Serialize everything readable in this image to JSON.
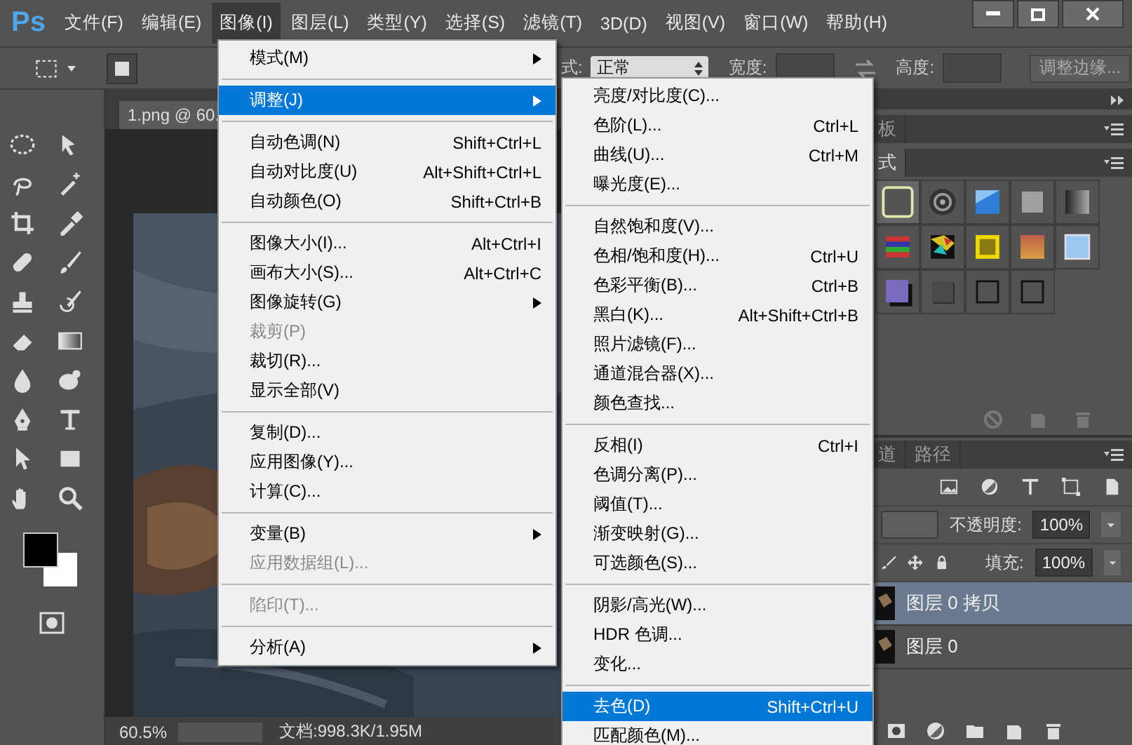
{
  "app": {
    "logo": "Ps"
  },
  "menubar": [
    {
      "label": "文件(F)",
      "selected": false
    },
    {
      "label": "编辑(E)",
      "selected": false
    },
    {
      "label": "图像(I)",
      "selected": true
    },
    {
      "label": "图层(L)",
      "selected": false
    },
    {
      "label": "类型(Y)",
      "selected": false
    },
    {
      "label": "选择(S)",
      "selected": false
    },
    {
      "label": "滤镜(T)",
      "selected": false
    },
    {
      "label": "3D(D)",
      "selected": false
    },
    {
      "label": "视图(V)",
      "selected": false
    },
    {
      "label": "窗口(W)",
      "selected": false
    },
    {
      "label": "帮助(H)",
      "selected": false
    }
  ],
  "options_bar": {
    "style_label": "式:",
    "style_value": "正常",
    "width_label": "宽度:",
    "height_label": "高度:",
    "refine_button": "调整边缘..."
  },
  "document": {
    "tab": "1.png @ 60.",
    "zoom": "60.5%",
    "info": "文档:998.3K/1.95M"
  },
  "image_menu": {
    "groups": [
      [
        {
          "label": "模式(M)",
          "submenu": true,
          "disabled": false,
          "selected": false
        }
      ],
      [
        {
          "label": "调整(J)",
          "submenu": true,
          "disabled": false,
          "selected": true
        }
      ],
      [
        {
          "label": "自动色调(N)",
          "shortcut": "Shift+Ctrl+L",
          "submenu": false,
          "disabled": false,
          "selected": false
        },
        {
          "label": "自动对比度(U)",
          "shortcut": "Alt+Shift+Ctrl+L",
          "submenu": false,
          "disabled": false,
          "selected": false
        },
        {
          "label": "自动颜色(O)",
          "shortcut": "Shift+Ctrl+B",
          "submenu": false,
          "disabled": false,
          "selected": false
        }
      ],
      [
        {
          "label": "图像大小(I)...",
          "shortcut": "Alt+Ctrl+I",
          "submenu": false,
          "disabled": false,
          "selected": false
        },
        {
          "label": "画布大小(S)...",
          "shortcut": "Alt+Ctrl+C",
          "submenu": false,
          "disabled": false,
          "selected": false
        },
        {
          "label": "图像旋转(G)",
          "submenu": true,
          "disabled": false,
          "selected": false
        },
        {
          "label": "裁剪(P)",
          "submenu": false,
          "disabled": true,
          "selected": false
        },
        {
          "label": "裁切(R)...",
          "submenu": false,
          "disabled": false,
          "selected": false
        },
        {
          "label": "显示全部(V)",
          "submenu": false,
          "disabled": false,
          "selected": false
        }
      ],
      [
        {
          "label": "复制(D)...",
          "submenu": false,
          "disabled": false,
          "selected": false
        },
        {
          "label": "应用图像(Y)...",
          "submenu": false,
          "disabled": false,
          "selected": false
        },
        {
          "label": "计算(C)...",
          "submenu": false,
          "disabled": false,
          "selected": false
        }
      ],
      [
        {
          "label": "变量(B)",
          "submenu": true,
          "disabled": false,
          "selected": false
        },
        {
          "label": "应用数据组(L)...",
          "submenu": false,
          "disabled": true,
          "selected": false
        }
      ],
      [
        {
          "label": "陷印(T)...",
          "submenu": false,
          "disabled": true,
          "selected": false
        }
      ],
      [
        {
          "label": "分析(A)",
          "submenu": true,
          "disabled": false,
          "selected": false
        }
      ]
    ]
  },
  "adjust_menu": {
    "groups": [
      [
        {
          "label": "亮度/对比度(C)...",
          "selected": false
        },
        {
          "label": "色阶(L)...",
          "shortcut": "Ctrl+L",
          "selected": false
        },
        {
          "label": "曲线(U)...",
          "shortcut": "Ctrl+M",
          "selected": false
        },
        {
          "label": "曝光度(E)...",
          "selected": false
        }
      ],
      [
        {
          "label": "自然饱和度(V)...",
          "selected": false
        },
        {
          "label": "色相/饱和度(H)...",
          "shortcut": "Ctrl+U",
          "selected": false
        },
        {
          "label": "色彩平衡(B)...",
          "shortcut": "Ctrl+B",
          "selected": false
        },
        {
          "label": "黑白(K)...",
          "shortcut": "Alt+Shift+Ctrl+B",
          "selected": false
        },
        {
          "label": "照片滤镜(F)...",
          "selected": false
        },
        {
          "label": "通道混合器(X)...",
          "selected": false
        },
        {
          "label": "颜色查找...",
          "selected": false
        }
      ],
      [
        {
          "label": "反相(I)",
          "shortcut": "Ctrl+I",
          "selected": false
        },
        {
          "label": "色调分离(P)...",
          "selected": false
        },
        {
          "label": "阈值(T)...",
          "selected": false
        },
        {
          "label": "渐变映射(G)...",
          "selected": false
        },
        {
          "label": "可选颜色(S)...",
          "selected": false
        }
      ],
      [
        {
          "label": "阴影/高光(W)...",
          "selected": false
        },
        {
          "label": "HDR 色调...",
          "selected": false
        },
        {
          "label": "变化...",
          "selected": false
        }
      ],
      [
        {
          "label": "去色(D)",
          "shortcut": "Shift+Ctrl+U",
          "selected": true
        },
        {
          "label": "匹配颜色(M)...",
          "selected": false
        }
      ]
    ]
  },
  "styles_panel": {
    "tabs": [
      {
        "label": "板",
        "selected": false
      },
      {
        "label": "式",
        "selected": true
      }
    ],
    "swatches": [
      {
        "kind": "frame",
        "selected": true
      },
      {
        "kind": "target",
        "selected": false
      },
      {
        "kind": "glass",
        "selected": false
      },
      {
        "kind": "flat",
        "selected": false
      },
      {
        "kind": "fade",
        "selected": false
      },
      {
        "kind": "stripes",
        "selected": false
      },
      {
        "kind": "mosaic",
        "selected": false
      },
      {
        "kind": "gold",
        "selected": false
      },
      {
        "kind": "sunset",
        "selected": false
      },
      {
        "kind": "sky",
        "selected": false
      },
      {
        "kind": "violet",
        "selected": false
      },
      {
        "kind": "shade",
        "selected": false
      },
      {
        "kind": "outline",
        "selected": false
      },
      {
        "kind": "outline",
        "selected": false
      }
    ]
  },
  "layers_panel": {
    "tabs": [
      {
        "label": "道",
        "selected": false
      },
      {
        "label": "路径",
        "selected": false
      }
    ],
    "opacity_label": "不透明度:",
    "opacity": "100%",
    "fill_label": "填充:",
    "fill": "100%",
    "layers": [
      {
        "name": "图层 0 拷贝",
        "selected": true
      },
      {
        "name": "图层 0",
        "selected": false
      }
    ]
  }
}
